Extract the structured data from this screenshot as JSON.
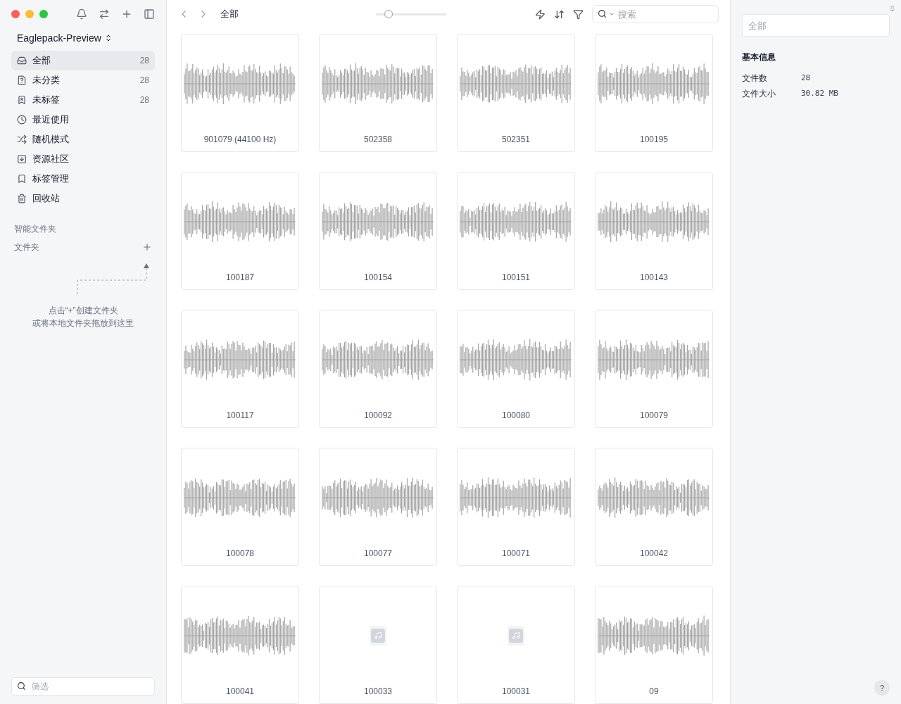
{
  "library": {
    "name": "Eaglepack-Preview"
  },
  "nav": [
    {
      "kind": "all",
      "label": "全部",
      "count": "28",
      "selected": true
    },
    {
      "kind": "unsorted",
      "label": "未分类",
      "count": "28",
      "selected": false
    },
    {
      "kind": "untagged",
      "label": "未标签",
      "count": "28",
      "selected": false
    },
    {
      "kind": "recent",
      "label": "最近使用",
      "selected": false
    },
    {
      "kind": "random",
      "label": "随机模式",
      "selected": false
    },
    {
      "kind": "community",
      "label": "资源社区",
      "selected": false
    },
    {
      "kind": "tags",
      "label": "标签管理",
      "selected": false
    },
    {
      "kind": "trash",
      "label": "回收站",
      "selected": false
    }
  ],
  "smart_folders": {
    "title": "智能文件夹"
  },
  "folders": {
    "title": "文件夹",
    "hint": [
      "点击“+”创建文件夹",
      "或将本地文件夹拖放到这里"
    ]
  },
  "filter": {
    "placeholder": "筛选"
  },
  "toolbar": {
    "title": "全部",
    "zoom": {
      "level": 0.18
    },
    "search": {
      "placeholder": "搜索"
    }
  },
  "items": [
    {
      "kind": "waveform",
      "name": "901079 (44100 Hz)"
    },
    {
      "kind": "waveform",
      "name": "502358"
    },
    {
      "kind": "waveform",
      "name": "502351"
    },
    {
      "kind": "waveform",
      "name": "100195"
    },
    {
      "kind": "waveform",
      "name": "100187"
    },
    {
      "kind": "waveform",
      "name": "100154"
    },
    {
      "kind": "waveform",
      "name": "100151"
    },
    {
      "kind": "waveform",
      "name": "100143"
    },
    {
      "kind": "waveform",
      "name": "100117"
    },
    {
      "kind": "waveform",
      "name": "100092"
    },
    {
      "kind": "waveform",
      "name": "100080"
    },
    {
      "kind": "waveform",
      "name": "100079"
    },
    {
      "kind": "waveform",
      "name": "100078"
    },
    {
      "kind": "waveform",
      "name": "100077"
    },
    {
      "kind": "waveform",
      "name": "100071"
    },
    {
      "kind": "waveform",
      "name": "100042"
    },
    {
      "kind": "waveform",
      "name": "100041"
    },
    {
      "kind": "file",
      "name": "100033"
    },
    {
      "kind": "file",
      "name": "100031"
    },
    {
      "kind": "waveform",
      "name": "09"
    }
  ],
  "inspector": {
    "name_field": {
      "placeholder": "全部"
    },
    "section": "基本信息",
    "rows": [
      {
        "label": "文件数",
        "value": "28"
      },
      {
        "label": "文件大小",
        "value": "30.82 MB"
      }
    ]
  },
  "help": {
    "label": "?"
  }
}
